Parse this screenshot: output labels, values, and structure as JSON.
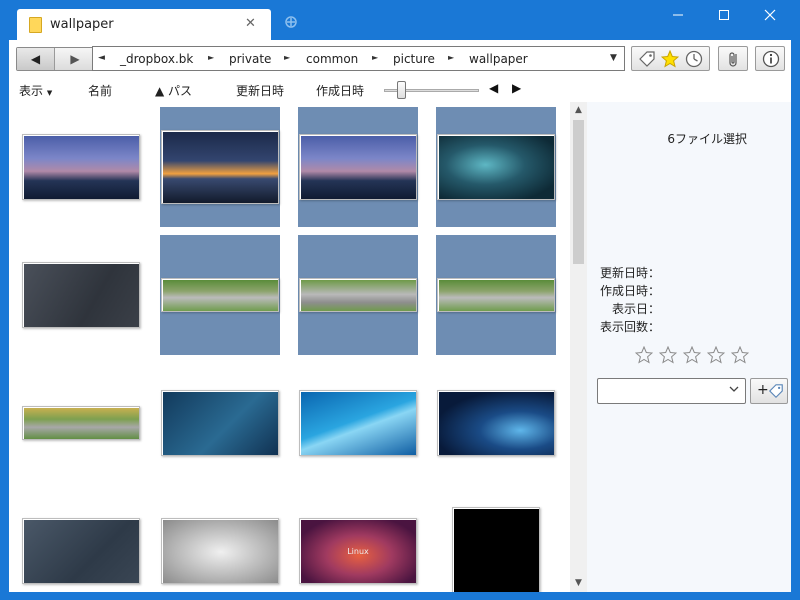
{
  "window": {
    "tab_title": "wallpaper"
  },
  "nav": {
    "back_glyph": "◀",
    "forward_glyph": "▶"
  },
  "address": {
    "left_arrow": "◄",
    "crumbs": [
      "_dropbox.bk",
      "private",
      "common",
      "picture",
      "wallpaper"
    ],
    "sep_glyph": "►",
    "dropdown_glyph": "▼"
  },
  "sortbar": {
    "view_label": "表示",
    "name_label": "名前",
    "path_label": "▲ パス",
    "modified_label": "更新日時",
    "created_label": "作成日時",
    "zoom_level": 0.2,
    "left_glyph": "◀",
    "right_glyph": "▶"
  },
  "thumbnails": [
    {
      "row": 0,
      "col": 0,
      "selected": false,
      "kind": "city-dusk"
    },
    {
      "row": 0,
      "col": 1,
      "selected": true,
      "kind": "city-bridge"
    },
    {
      "row": 0,
      "col": 2,
      "selected": true,
      "kind": "city-dusk"
    },
    {
      "row": 0,
      "col": 3,
      "selected": true,
      "kind": "windows-teal"
    },
    {
      "row": 1,
      "col": 0,
      "selected": false,
      "kind": "gray-diamond"
    },
    {
      "row": 1,
      "col": 1,
      "selected": true,
      "kind": "race-track"
    },
    {
      "row": 1,
      "col": 2,
      "selected": true,
      "kind": "race-track-2"
    },
    {
      "row": 1,
      "col": 3,
      "selected": true,
      "kind": "race-track"
    },
    {
      "row": 2,
      "col": 0,
      "selected": false,
      "kind": "race-track-3"
    },
    {
      "row": 2,
      "col": 1,
      "selected": false,
      "kind": "blue-lines"
    },
    {
      "row": 2,
      "col": 2,
      "selected": false,
      "kind": "blue-wave"
    },
    {
      "row": 2,
      "col": 3,
      "selected": false,
      "kind": "dark-blue-wave"
    },
    {
      "row": 3,
      "col": 0,
      "selected": false,
      "kind": "gray-lines"
    },
    {
      "row": 3,
      "col": 1,
      "selected": false,
      "kind": "car"
    },
    {
      "row": 3,
      "col": 2,
      "selected": false,
      "kind": "linux"
    },
    {
      "row": 3,
      "col": 3,
      "selected": false,
      "kind": "black-portrait"
    }
  ],
  "thumb_text": {
    "linux": "Linux"
  },
  "panel": {
    "selection_count": "6ファイル選択",
    "modified": "更新日時：",
    "created": "作成日時：",
    "viewed": "表示日：",
    "view_count": "表示回数：",
    "rating_stars": 5,
    "rating_value": 0,
    "tag_add_label": "+"
  },
  "colors": {
    "accent": "#1a78d6",
    "selection": "#6e8db3"
  },
  "icons": {
    "tag": "tag-icon",
    "star": "star-icon",
    "clock": "clock-icon",
    "clip": "paperclip-icon",
    "info": "info-icon"
  }
}
